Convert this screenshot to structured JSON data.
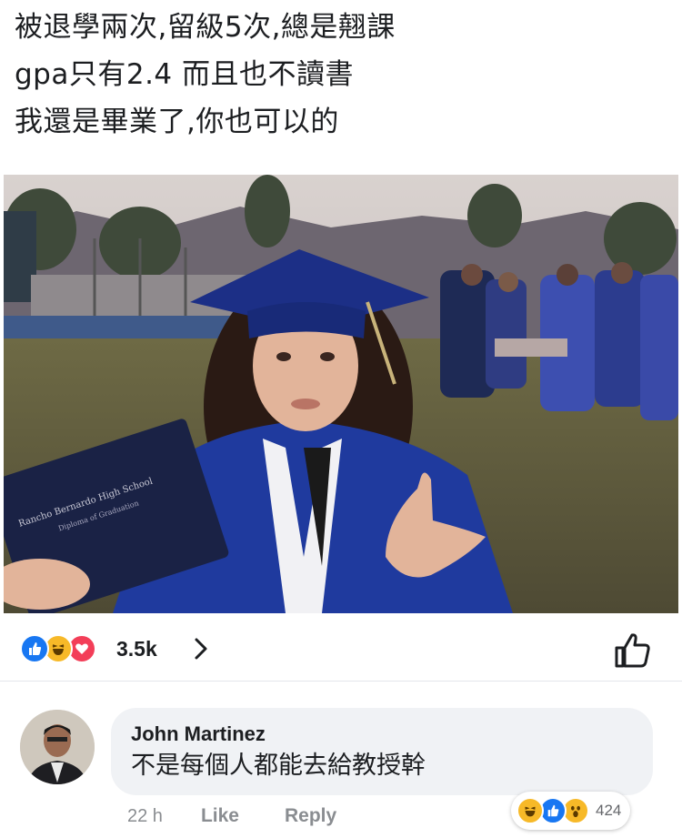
{
  "post": {
    "caption_lines": [
      "被退學兩次,留級5次,總是翹課",
      "gpa只有2.4 而且也不讀書",
      "我還是畢業了,你也可以的"
    ],
    "photo": {
      "diploma_text_line1": "Rancho Bernardo High School",
      "diploma_text_line2": "Diploma of Graduation"
    }
  },
  "reactions": {
    "icons": [
      "like-icon",
      "haha-icon",
      "love-icon"
    ],
    "count": "3.5k"
  },
  "comment": {
    "author": "John Martinez",
    "text": "不是每個人都能去給教授幹",
    "time": "22 h",
    "like_label": "Like",
    "reply_label": "Reply",
    "reaction_icons": [
      "haha-icon",
      "like-icon",
      "wow-icon"
    ],
    "reaction_count": "424"
  },
  "colors": {
    "like_blue": "#1877f2",
    "haha_yellow": "#f7b928",
    "love_red": "#f33e58",
    "bubble_gray": "#f0f2f5",
    "meta_gray": "#8a8d91"
  }
}
